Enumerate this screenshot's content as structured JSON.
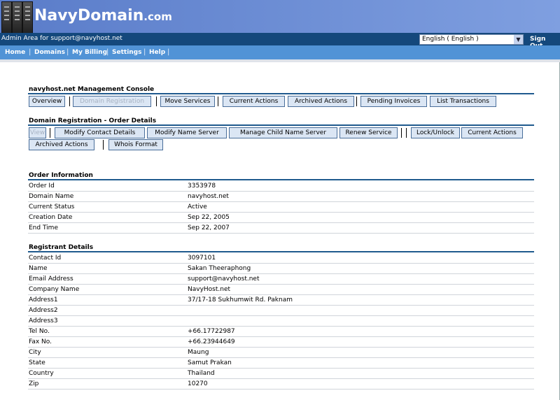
{
  "brand": {
    "name": "NavyDomain",
    "suffix": ".com"
  },
  "topbar": {
    "admin_label": "Admin Area for support@navyhost.net",
    "language": "English ( English )",
    "sign_out": "Sign Out"
  },
  "menu": [
    "Home",
    "Domains",
    "My Billing",
    "Settings",
    "Help"
  ],
  "console": {
    "title": "navyhost.net Management Console",
    "buttons": [
      "Overview",
      "Domain Registration",
      "Move Services",
      "Current Actions",
      "Archived Actions",
      "Pending Invoices",
      "List Transactions"
    ]
  },
  "order_details": {
    "title": "Domain Registration - Order Details",
    "buttons": [
      "View",
      "Modify Contact Details",
      "Modify Name Server",
      "Manage Child Name Server",
      "Renew Service",
      "Lock/Unlock",
      "Current Actions",
      "Archived Actions",
      "Whois Format"
    ]
  },
  "order_info": {
    "title": "Order Information",
    "rows": [
      {
        "label": "Order Id",
        "value": "3353978"
      },
      {
        "label": "Domain Name",
        "value": "navyhost.net"
      },
      {
        "label": "Current Status",
        "value": "Active"
      },
      {
        "label": "Creation Date",
        "value": "Sep 22, 2005"
      },
      {
        "label": "End Time",
        "value": "Sep 22, 2007"
      }
    ]
  },
  "registrant": {
    "title": "Registrant Details",
    "rows": [
      {
        "label": "Contact Id",
        "value": "3097101"
      },
      {
        "label": "Name",
        "value": "Sakan Theeraphong"
      },
      {
        "label": "Email Address",
        "value": "support@navyhost.net"
      },
      {
        "label": "Company Name",
        "value": "NavyHost.net"
      },
      {
        "label": "Address1",
        "value": "37/17-18 Sukhumwit Rd. Paknam"
      },
      {
        "label": "Address2",
        "value": ""
      },
      {
        "label": "Address3",
        "value": ""
      },
      {
        "label": "Tel No.",
        "value": "+66.17722987"
      },
      {
        "label": "Fax No.",
        "value": "+66.23944649"
      },
      {
        "label": "City",
        "value": "Maung"
      },
      {
        "label": "State",
        "value": "Samut Prakan"
      },
      {
        "label": "Country",
        "value": "Thailand"
      },
      {
        "label": "Zip",
        "value": "10270"
      }
    ]
  }
}
